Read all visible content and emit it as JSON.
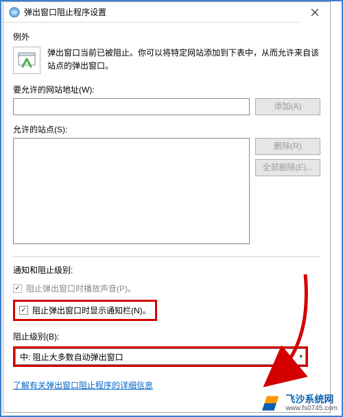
{
  "titlebar": {
    "title": "弹出窗口阻止程序设置"
  },
  "exceptions": {
    "label": "例外",
    "info": "弹出窗口当前已被阻止。你可以将特定网站添加到下表中，从而允许来自该站点的弹出窗口。",
    "addressLabel": "要允许的网站地址(W):",
    "addressValue": "",
    "addBtn": "添加(A)",
    "allowedLabel": "允许的站点(S):",
    "removeBtn": "删除(R)",
    "removeAllBtn": "全部删除(E)..."
  },
  "notif": {
    "sectionLabel": "通知和阻止级别:",
    "playSound": {
      "checked": true,
      "label": "阻止弹出窗口时播放声音(P)。"
    },
    "showBar": {
      "checked": true,
      "label": "阻止弹出窗口时显示通知栏(N)。"
    },
    "blockLevelLabel": "阻止级别(B):",
    "blockLevelValue": "中: 阻止大多数自动弹出窗口"
  },
  "link": {
    "text": "了解有关弹出窗口阻止程序的详细信息"
  },
  "watermark": {
    "cn": "飞沙系统网",
    "url": "www.fs0745.com"
  }
}
